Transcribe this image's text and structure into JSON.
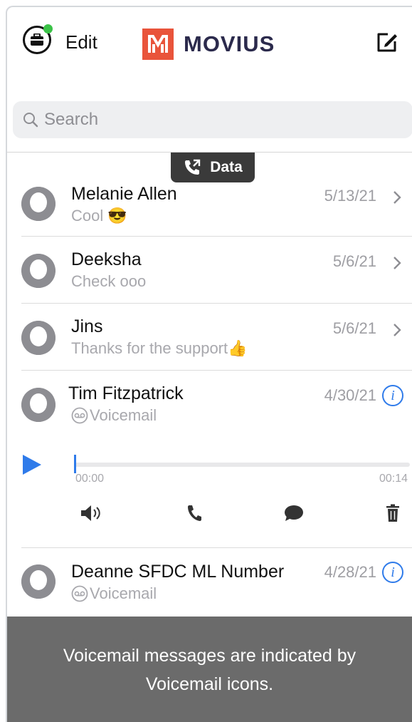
{
  "header": {
    "edit_label": "Edit",
    "brand": "MOVIUS",
    "brand_color": "#e9543b",
    "brand_text_color": "#2b2a4c",
    "status_dot_color": "#3ac247"
  },
  "search": {
    "placeholder": "Search"
  },
  "data_badge": {
    "label": "Data",
    "icon": "phone-transfer-icon"
  },
  "conversations": [
    {
      "name": "Melanie Allen",
      "preview": "Cool 😎",
      "date": "5/13/21",
      "action": "chevron"
    },
    {
      "name": "Deeksha",
      "preview": "Check ooo",
      "date": "5/6/21",
      "action": "chevron"
    },
    {
      "name": "Jins",
      "preview": "Thanks for the support👍",
      "date": "5/6/21",
      "action": "chevron"
    },
    {
      "name": "Tim Fitzpatrick",
      "preview": "Voicemail",
      "date": "4/30/21",
      "action": "info",
      "voicemail": true
    },
    {
      "name": "Deanne SFDC ML Number",
      "preview": "Voicemail",
      "date": "4/28/21",
      "action": "info",
      "voicemail": true
    }
  ],
  "player": {
    "elapsed": "00:00",
    "duration": "00:14",
    "progress": 0,
    "accent": "#2f7bea",
    "actions": [
      "speaker-icon",
      "phone-icon",
      "chat-bubble-icon",
      "trash-icon"
    ]
  },
  "overlay": {
    "caption": "Voicemail messages are indicated by Voicemail icons."
  }
}
